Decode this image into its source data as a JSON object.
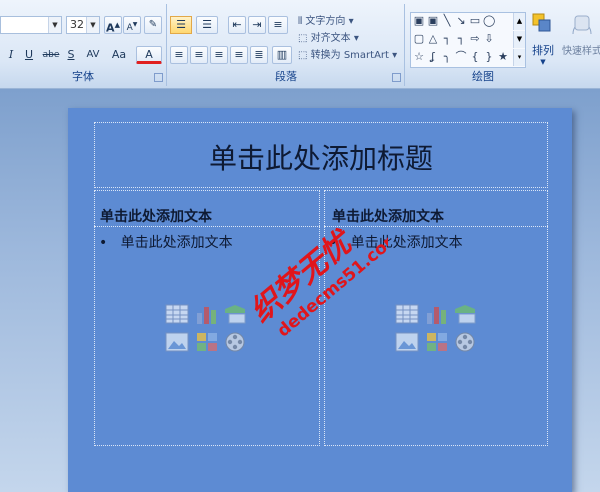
{
  "ribbon": {
    "font": {
      "label": "字体",
      "size_value": "32",
      "grow_label": "A",
      "shrink_label": "A",
      "italic_label": "I",
      "underline_label": "U",
      "strike_label": "abe",
      "shadow_label": "S",
      "spacing_label": "AV",
      "case_label": "Aa",
      "color_label": "A"
    },
    "paragraph": {
      "label": "段落",
      "text_direction": "文字方向",
      "align_text": "对齐文本",
      "convert_smartart": "转换为 SmartArt"
    },
    "drawing": {
      "label": "绘图",
      "arrange": "排列",
      "quick_styles": "快速样式"
    }
  },
  "slide": {
    "title": "单击此处添加标题",
    "left": {
      "heading": "单击此处添加文本",
      "bullet": "单击此处添加文本"
    },
    "right": {
      "heading": "单击此处添加文本",
      "bullet": "单击此处添加文本"
    }
  },
  "watermark": {
    "line1": "织梦无忧",
    "line2": "dedecms51.com",
    "color": "#e0151b"
  }
}
